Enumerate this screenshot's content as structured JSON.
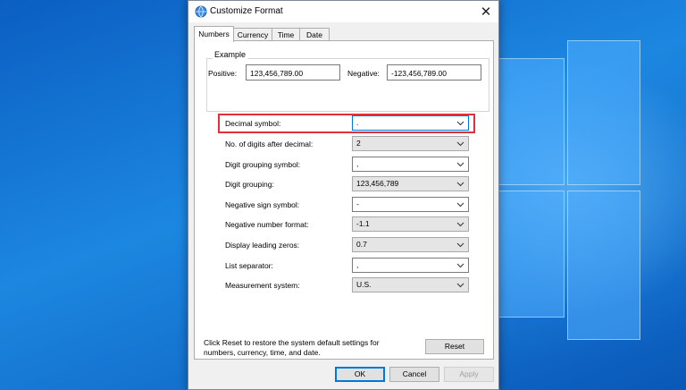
{
  "dialog": {
    "title": "Customize Format",
    "close_glyph": "✕",
    "tabs": [
      {
        "label": "Numbers",
        "active": true
      },
      {
        "label": "Currency",
        "active": false
      },
      {
        "label": "Time",
        "active": false
      },
      {
        "label": "Date",
        "active": false
      }
    ],
    "example": {
      "heading": "Example",
      "positive_label": "Positive:",
      "positive_value": "123,456,789.00",
      "negative_label": "Negative:",
      "negative_value": "-123,456,789.00"
    },
    "settings": [
      {
        "label": "Decimal symbol:",
        "value": ".",
        "editable": true,
        "highlighted": true
      },
      {
        "label": "No. of digits after decimal:",
        "value": "2",
        "editable": false
      },
      {
        "label": "Digit grouping symbol:",
        "value": ",",
        "editable": true
      },
      {
        "label": "Digit grouping:",
        "value": "123,456,789",
        "editable": false
      },
      {
        "label": "Negative sign symbol:",
        "value": "-",
        "editable": true
      },
      {
        "label": "Negative number format:",
        "value": "-1.1",
        "editable": false
      },
      {
        "label": "Display leading zeros:",
        "value": "0.7",
        "editable": false
      },
      {
        "label": "List separator:",
        "value": ",",
        "editable": true
      },
      {
        "label": "Measurement system:",
        "value": "U.S.",
        "editable": false
      }
    ],
    "footer_text": "Click Reset to restore the system default settings for numbers, currency, time, and date.",
    "buttons": {
      "reset": "Reset",
      "ok": "OK",
      "cancel": "Cancel",
      "apply": "Apply"
    }
  },
  "colors": {
    "highlight": "#e0303a",
    "focus": "#0078d7"
  },
  "icons": {
    "title": "globe-settings-icon",
    "close": "close-icon",
    "dropdown": "chevron-down-icon"
  }
}
